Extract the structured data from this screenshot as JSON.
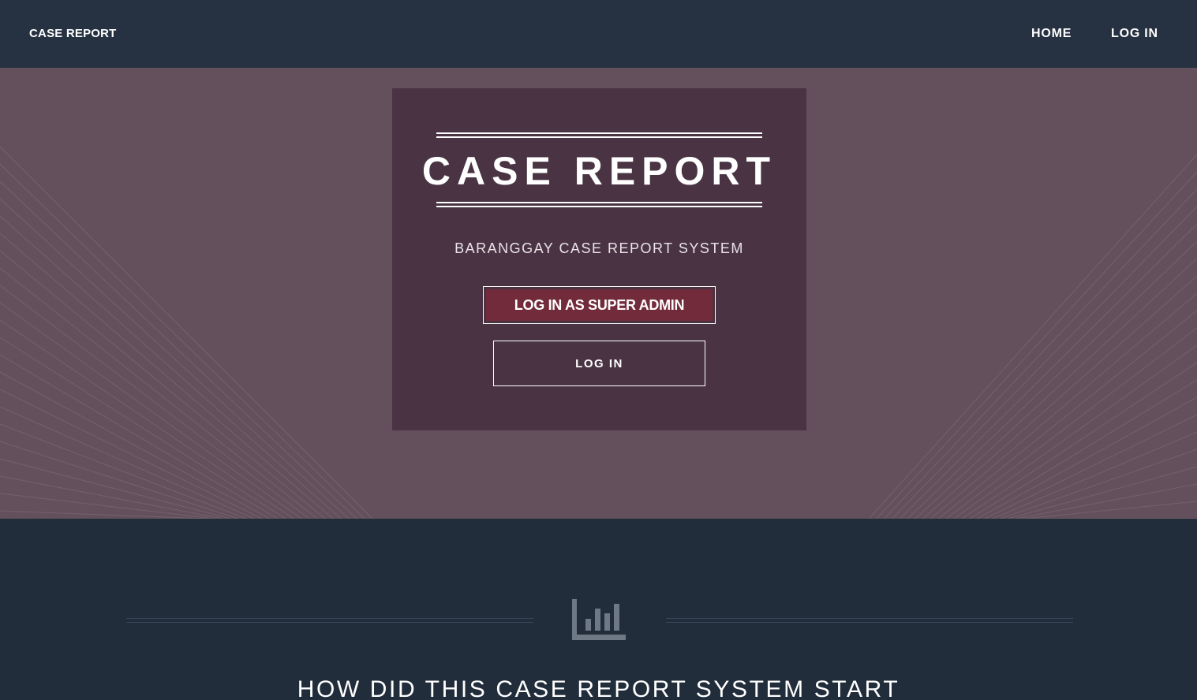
{
  "navbar": {
    "brand": "CASE REPORT",
    "links": [
      "HOME",
      "LOG IN"
    ]
  },
  "hero": {
    "title": "CASE REPORT",
    "subtitle": "BARANGGAY CASE REPORT SYSTEM",
    "primary_button": "LOG IN AS SUPER ADMIN",
    "secondary_button": "LOG IN"
  },
  "about": {
    "icon": "bar-chart-icon",
    "heading": "HOW DID THIS CASE REPORT SYSTEM START"
  },
  "colors": {
    "navbar_bg": "#263141",
    "hero_bg": "#64505c",
    "card_bg": "#4a3444",
    "primary_button_bg": "#722b3a",
    "section_bg": "#212d3b"
  }
}
